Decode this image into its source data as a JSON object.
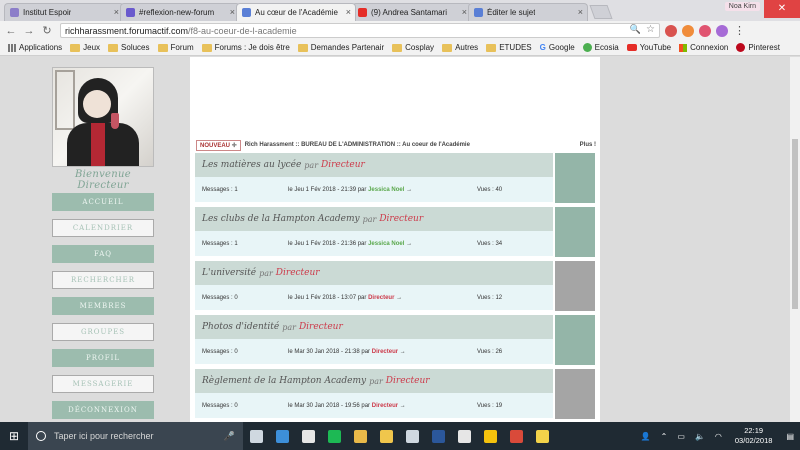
{
  "browser": {
    "tabs": [
      {
        "label": "Institut Espoir",
        "fav_color": "#8c7ec9",
        "active": false
      },
      {
        "label": "#reflexion-new-forum",
        "fav_color": "#6a5acd",
        "active": false
      },
      {
        "label": "Au cœur de l'Académie",
        "fav_color": "#5a7fd6",
        "active": true
      },
      {
        "label": "(9) Andrea Santamari",
        "fav_color": "#e52d27",
        "active": false
      },
      {
        "label": "Éditer le sujet",
        "fav_color": "#5a7fd6",
        "active": false
      }
    ],
    "profile_chip": "Noa Kirn",
    "url_host": "richharassment.forumactif.com",
    "url_path": "/f8-au-coeur-de-l-academie",
    "bookmarks": [
      {
        "label": "Applications",
        "icon": "apps-icon"
      },
      {
        "label": "Jeux",
        "icon": "folder-icon"
      },
      {
        "label": "Soluces",
        "icon": "folder-icon"
      },
      {
        "label": "Forum",
        "icon": "folder-icon"
      },
      {
        "label": "Forums : Je dois être",
        "icon": "folder-icon"
      },
      {
        "label": "Demandes Partenair",
        "icon": "folder-icon"
      },
      {
        "label": "Cosplay",
        "icon": "folder-icon"
      },
      {
        "label": "Autres",
        "icon": "folder-icon"
      },
      {
        "label": "ETUDES",
        "icon": "folder-icon"
      },
      {
        "label": "Google",
        "icon": "google-icon"
      },
      {
        "label": "Ecosia",
        "icon": "ecosia-icon"
      },
      {
        "label": "YouTube",
        "icon": "youtube-icon"
      },
      {
        "label": "Connexion",
        "icon": "microsoft-icon"
      },
      {
        "label": "Pinterest",
        "icon": "pinterest-icon"
      }
    ]
  },
  "sidebar": {
    "welcome": "Bienvenue Directeur",
    "menu": [
      {
        "label": "ACCUEIL",
        "style": "filled"
      },
      {
        "label": "CALENDRIER",
        "style": "outline"
      },
      {
        "label": "FAQ",
        "style": "filled"
      },
      {
        "label": "RECHERCHER",
        "style": "outline"
      },
      {
        "label": "MEMBRES",
        "style": "filled"
      },
      {
        "label": "GROUPES",
        "style": "outline"
      },
      {
        "label": "PROFIL",
        "style": "filled"
      },
      {
        "label": "MESSAGERIE",
        "style": "outline"
      },
      {
        "label": "DÉCONNEXION",
        "style": "filled"
      }
    ]
  },
  "forum": {
    "new_label": "NOUVEAU",
    "breadcrumb": "Rich Harassment :: BUREAU DE L'ADMINISTRATION :: Au coeur de l'Académie",
    "plus": "Plus !",
    "topics": [
      {
        "title": "Les matières au lycée",
        "by": "par",
        "author": "Directeur",
        "messages": "Messages : 1",
        "date": "le Jeu 1 Fév 2018 - 21:39 par",
        "last": "Jessica Noel",
        "last_red": false,
        "arrow": "→",
        "views": "Vues : 40",
        "side_color": "#94b5a8"
      },
      {
        "title": "Les clubs de la Hampton Academy",
        "by": "par",
        "author": "Directeur",
        "messages": "Messages : 1",
        "date": "le Jeu 1 Fév 2018 - 21:36 par",
        "last": "Jessica Noel",
        "last_red": false,
        "arrow": "→",
        "views": "Vues : 34",
        "side_color": "#94b5a8"
      },
      {
        "title": "L'université",
        "by": "par",
        "author": "Directeur",
        "messages": "Messages : 0",
        "date": "le Jeu 1 Fév 2018 - 13:07 par",
        "last": "Directeur",
        "last_red": true,
        "arrow": "→",
        "views": "Vues : 12",
        "side_color": "#a5a5a5"
      },
      {
        "title": "Photos d'identité",
        "by": "par",
        "author": "Directeur",
        "messages": "Messages : 0",
        "date": "le Mar 30 Jan 2018 - 21:38 par",
        "last": "Directeur",
        "last_red": true,
        "arrow": "→",
        "views": "Vues : 26",
        "side_color": "#94b5a8"
      },
      {
        "title": "Règlement de la Hampton Academy",
        "by": "par",
        "author": "Directeur",
        "messages": "Messages : 0",
        "date": "le Mar 30 Jan 2018 - 19:56 par",
        "last": "Directeur",
        "last_red": true,
        "arrow": "→",
        "views": "Vues : 19",
        "side_color": "#a5a5a5"
      }
    ]
  },
  "taskbar": {
    "search_placeholder": "Taper ici pour rechercher",
    "time": "22:19",
    "date": "03/02/2018",
    "apps": [
      {
        "name": "task-view-icon",
        "color": "#cfd8e0"
      },
      {
        "name": "edge-icon",
        "color": "#3d8fd9"
      },
      {
        "name": "store-icon",
        "color": "#e6e6e6"
      },
      {
        "name": "spotify-icon",
        "color": "#1db954"
      },
      {
        "name": "paint-icon",
        "color": "#e9b949"
      },
      {
        "name": "explorer-icon",
        "color": "#f0c64c"
      },
      {
        "name": "steam-icon",
        "color": "#cfd8e0"
      },
      {
        "name": "word-icon",
        "color": "#2b579a"
      },
      {
        "name": "mail-icon",
        "color": "#e6e6e6"
      },
      {
        "name": "chrome-icon",
        "color": "#f4c20d"
      },
      {
        "name": "game-icon",
        "color": "#d94a3a"
      },
      {
        "name": "notes-icon",
        "color": "#f3d34a"
      }
    ]
  }
}
